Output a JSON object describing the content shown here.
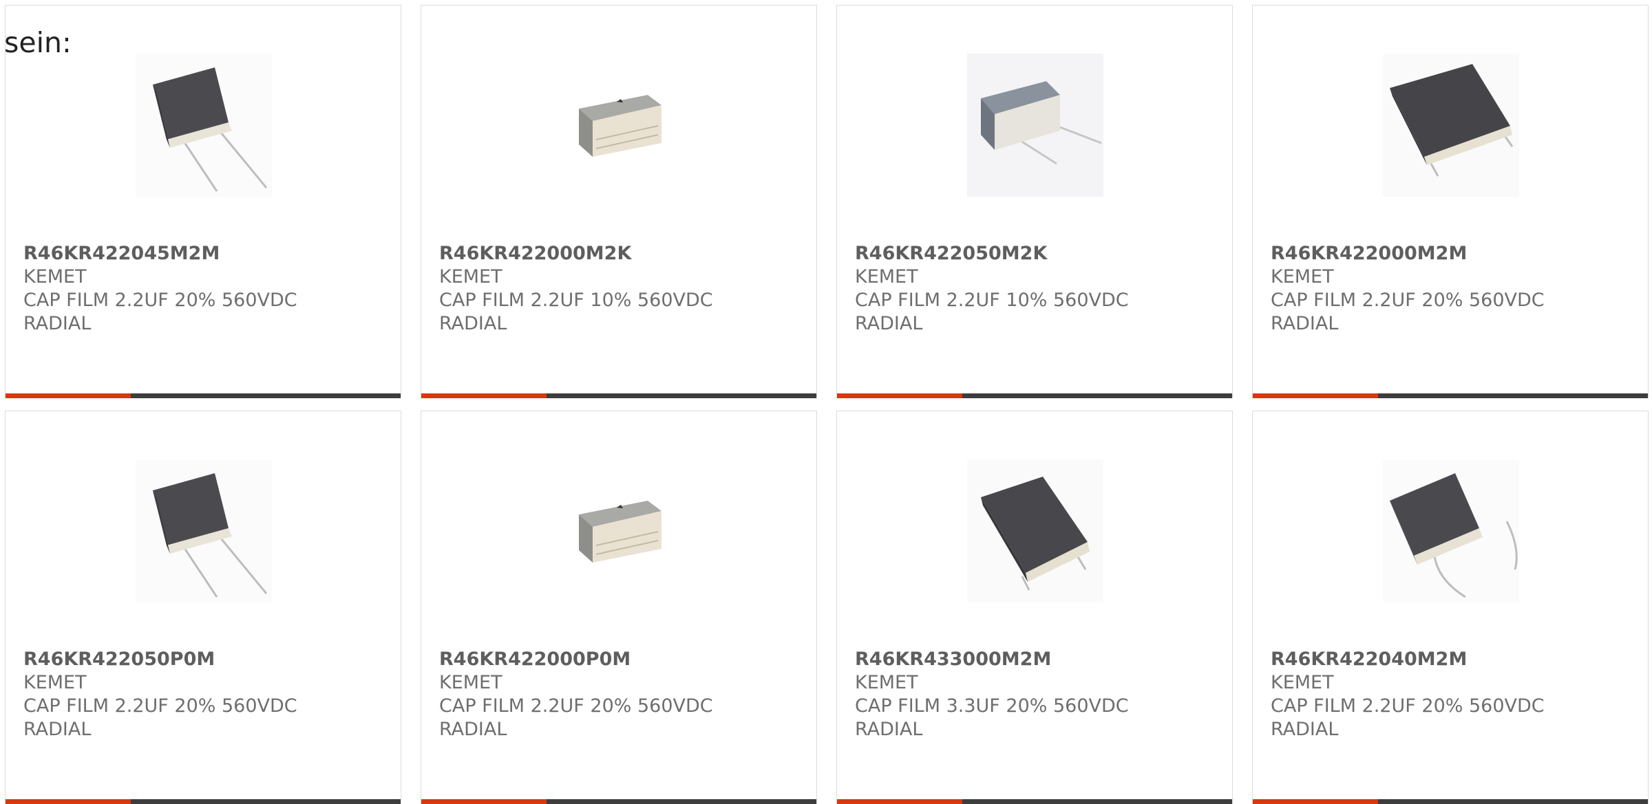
{
  "intro_text": "sein:",
  "colors": {
    "accent": "#d9380e",
    "bar": "#3d3d3d",
    "text": "#6e6e6e"
  },
  "products": [
    {
      "part": "R46KR422045M2M",
      "maker": "KEMET",
      "desc": "CAP FILM 2.2UF 20% 560VDC",
      "pkg": "RADIAL",
      "image": "capacitor-photo"
    },
    {
      "part": "R46KR422000M2K",
      "maker": "KEMET",
      "desc": "CAP FILM 2.2UF 10% 560VDC",
      "pkg": "RADIAL",
      "image": "capacitor-photo"
    },
    {
      "part": "R46KR422050M2K",
      "maker": "KEMET",
      "desc": "CAP FILM 2.2UF 10% 560VDC",
      "pkg": "RADIAL",
      "image": "capacitor-photo"
    },
    {
      "part": "R46KR422000M2M",
      "maker": "KEMET",
      "desc": "CAP FILM 2.2UF 20% 560VDC",
      "pkg": "RADIAL",
      "image": "capacitor-photo"
    },
    {
      "part": "R46KR422050P0M",
      "maker": "KEMET",
      "desc": "CAP FILM 2.2UF 20% 560VDC",
      "pkg": "RADIAL",
      "image": "capacitor-photo"
    },
    {
      "part": "R46KR422000P0M",
      "maker": "KEMET",
      "desc": "CAP FILM 2.2UF 20% 560VDC",
      "pkg": "RADIAL",
      "image": "capacitor-photo"
    },
    {
      "part": "R46KR433000M2M",
      "maker": "KEMET",
      "desc": "CAP FILM 3.3UF 20% 560VDC",
      "pkg": "RADIAL",
      "image": "capacitor-photo"
    },
    {
      "part": "R46KR422040M2M",
      "maker": "KEMET",
      "desc": "CAP FILM 2.2UF 20% 560VDC",
      "pkg": "RADIAL",
      "image": "capacitor-photo"
    }
  ]
}
